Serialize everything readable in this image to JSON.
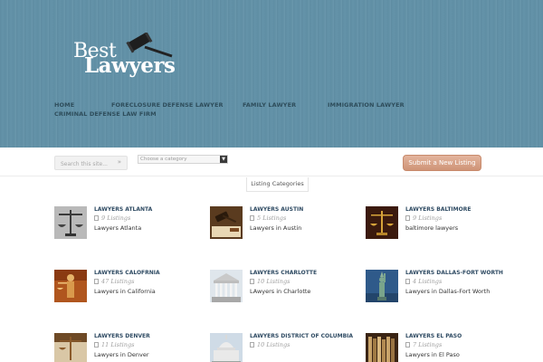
{
  "brand": {
    "line1": "Best",
    "line2": "Lawyers"
  },
  "nav": {
    "items": [
      "HOME",
      "FORECLOSURE DEFENSE LAWYER",
      "FAMILY LAWYER",
      "IMMIGRATION LAWYER",
      "CRIMINAL DEFENSE LAW FIRM"
    ]
  },
  "search": {
    "placeholder": "Search this site..."
  },
  "category_select": {
    "selected": "Choose a category"
  },
  "submit": {
    "label": "Submit a New Listing"
  },
  "section": {
    "title": "Listing Categories"
  },
  "listings": [
    {
      "title": "LAWYERS ATLANTA",
      "count": "9 Listings",
      "desc": "Lawyers Atlanta",
      "thumb": "scales-gray"
    },
    {
      "title": "LAWYERS AUSTIN",
      "count": "5 Listings",
      "desc": "Lawyers in Austin",
      "thumb": "gavel-book"
    },
    {
      "title": "LAWYERS BALTIMORE",
      "count": "9 Listings",
      "desc": "baltimore lawyers",
      "thumb": "scales-dark"
    },
    {
      "title": "LAWYERS CALOFRNIA",
      "count": "47 Listings",
      "desc": "Lawyers in California",
      "thumb": "justice-statue"
    },
    {
      "title": "LAWYERS CHARLOTTE",
      "count": "10 Listings",
      "desc": "LAwyers in Charlotte",
      "thumb": "courthouse"
    },
    {
      "title": "LAWYERS DALLAS-FORT WORTH",
      "count": "4 Listings",
      "desc": "Lawyers in Dallas-Fort Worth",
      "thumb": "liberty"
    },
    {
      "title": "LAWYERS DENVER",
      "count": "11 Listings",
      "desc": "Lawyers in Denver",
      "thumb": "scales-brown"
    },
    {
      "title": "LAWYERS DISTRICT OF COLUMBIA",
      "count": "10 Listings",
      "desc": "",
      "thumb": "capitol"
    },
    {
      "title": "LAWYERS EL PASO",
      "count": "7 Listings",
      "desc": "Lawyers in El Paso",
      "thumb": "books"
    }
  ],
  "colors": {
    "header": "#6391a7",
    "accent": "#d39a7d",
    "title": "#2f4b63"
  }
}
